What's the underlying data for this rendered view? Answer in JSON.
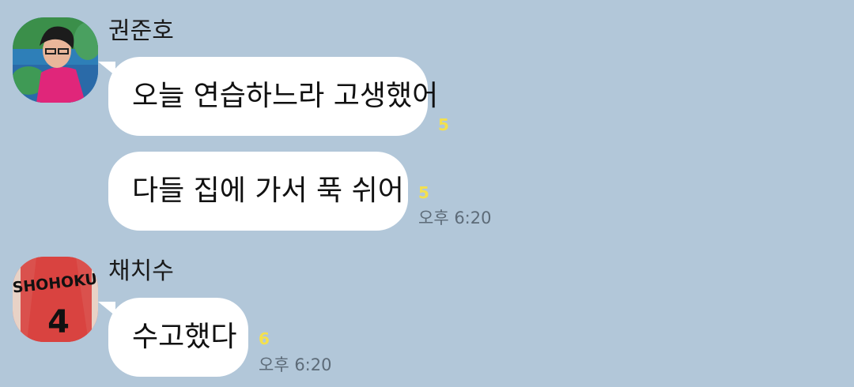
{
  "chat": {
    "groups": [
      {
        "sender": "권준호",
        "avatar_icon": "manga-character-avatar-icon",
        "messages": [
          {
            "text": "오늘 연습하느라 고생했어",
            "unread": "5"
          },
          {
            "text": "다들 집에 가서 푹 쉬어",
            "unread": "5",
            "time": "오후 6:20"
          }
        ]
      },
      {
        "sender": "채치수",
        "avatar_icon": "basketball-jersey-avatar-icon",
        "avatar_jersey_text": "SHOHOKU",
        "avatar_jersey_number": "4",
        "messages": [
          {
            "text": "수고했다",
            "unread": "6",
            "time": "오후 6:20"
          }
        ]
      }
    ]
  },
  "colors": {
    "background": "#b2c7d9",
    "bubble": "#ffffff",
    "unread": "#f4e04d",
    "time": "#5d6b78"
  }
}
